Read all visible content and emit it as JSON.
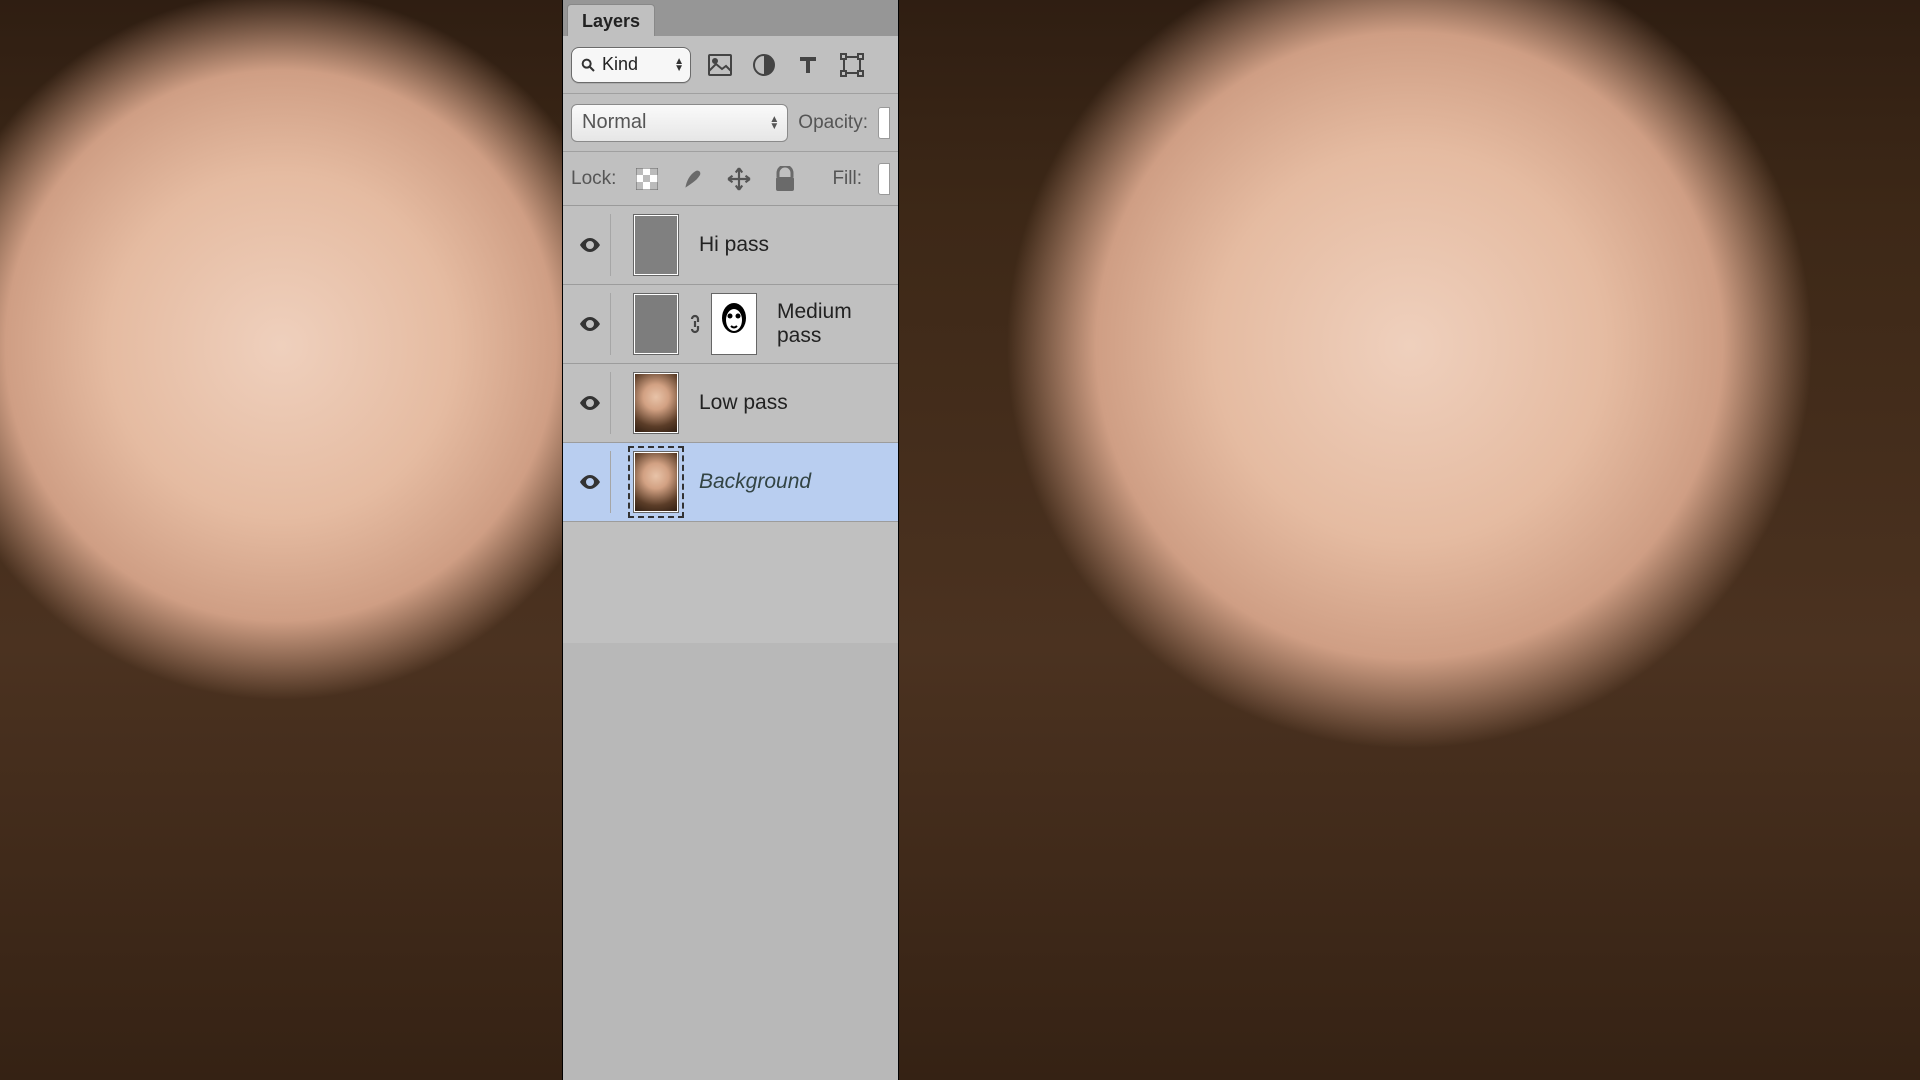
{
  "panel": {
    "tab_label": "Layers",
    "filter": {
      "kind_label": "Kind"
    },
    "blend": {
      "mode": "Normal",
      "opacity_label": "Opacity:"
    },
    "lock": {
      "label": "Lock:",
      "fill_label": "Fill:"
    },
    "layers": [
      {
        "name": "Hi pass",
        "thumb_type": "gray",
        "selected": false,
        "italic": false,
        "has_mask": false
      },
      {
        "name": "Medium pass",
        "thumb_type": "gray2",
        "selected": false,
        "italic": false,
        "has_mask": true
      },
      {
        "name": "Low pass",
        "thumb_type": "portrait",
        "selected": false,
        "italic": false,
        "has_mask": false
      },
      {
        "name": "Background",
        "thumb_type": "portrait",
        "selected": true,
        "italic": true,
        "has_mask": false
      }
    ]
  }
}
